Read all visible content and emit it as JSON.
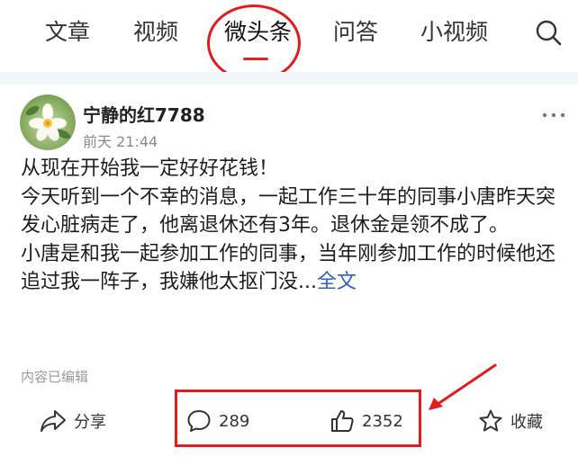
{
  "tabs": [
    {
      "label": "文章"
    },
    {
      "label": "视频"
    },
    {
      "label": "微头条",
      "active": true
    },
    {
      "label": "问答"
    },
    {
      "label": "小视频"
    }
  ],
  "post": {
    "author": "宁静的红7788",
    "time": "前天 21:44",
    "paragraphs": [
      "从现在开始我一定好好花钱！",
      "今天听到一个不幸的消息，一起工作三十年的同事小唐昨天突发心脏病走了，他离退休还有3年。退休金是领不成了。",
      "小唐是和我一起参加工作的同事，当年刚参加工作的时候他还追过我一阵子，我嫌他太抠门没..."
    ],
    "full_text_link": "全文",
    "edited_note": "内容已编辑"
  },
  "actions": {
    "share_label": "分享",
    "comment_count": "289",
    "like_count": "2352",
    "favorite_label": "收藏"
  },
  "icons": {
    "search": "search-icon",
    "more": "more-dots-icon",
    "share": "share-icon",
    "comment": "comment-icon",
    "like": "thumbs-up-icon",
    "favorite": "star-icon"
  },
  "colors": {
    "accent": "#e02424",
    "annotation": "#e31b1b",
    "link": "#2f62b8",
    "meta": "#8a8a8a"
  }
}
